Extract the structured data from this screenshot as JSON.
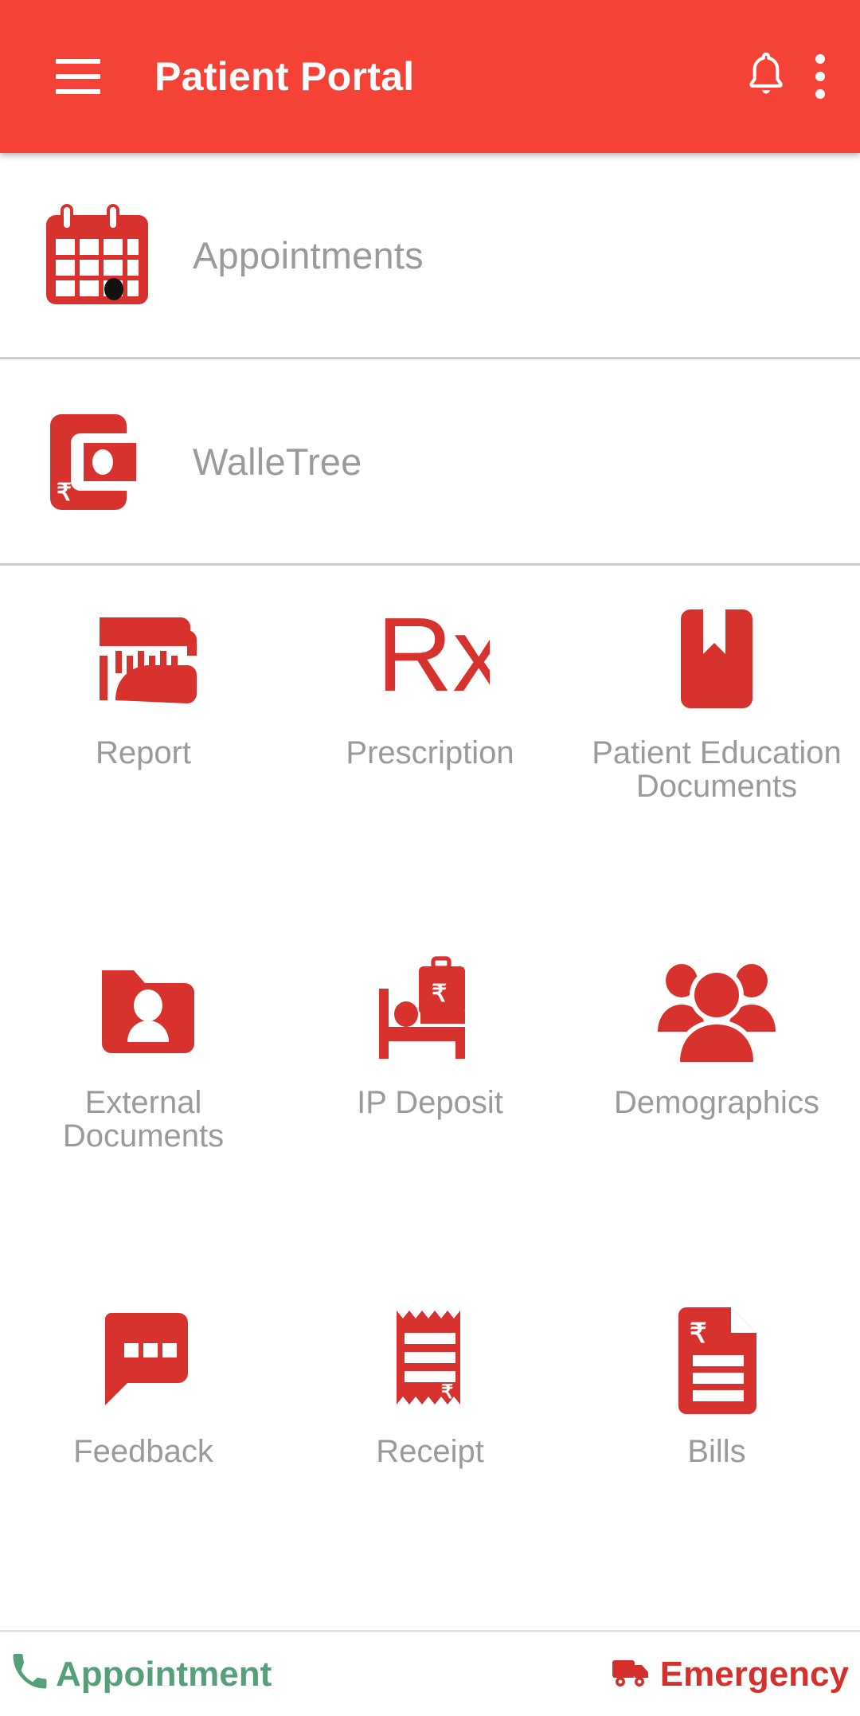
{
  "appbar": {
    "title": "Patient Portal",
    "menu_icon": "hamburger-menu-icon",
    "notification_icon": "bell-icon",
    "overflow_icon": "more-vertical-icon"
  },
  "list_rows": [
    {
      "label": "Appointments",
      "icon": "calendar-icon"
    },
    {
      "label": "WalleTree",
      "icon": "wallet-rupee-icon"
    }
  ],
  "grid": [
    {
      "label": "Report",
      "icon": "folder-chart-icon"
    },
    {
      "label": "Prescription",
      "icon": "rx-icon",
      "glyph": "Rx"
    },
    {
      "label": "Patient Education Documents",
      "icon": "book-bookmark-icon"
    },
    {
      "label": "External Documents",
      "icon": "folder-person-icon"
    },
    {
      "label": "IP Deposit",
      "icon": "bed-money-bag-icon"
    },
    {
      "label": "Demographics",
      "icon": "people-group-icon"
    },
    {
      "label": "Feedback",
      "icon": "chat-bubble-dots-icon"
    },
    {
      "label": "Receipt",
      "icon": "receipt-rupee-icon"
    },
    {
      "label": "Bills",
      "icon": "document-rupee-icon"
    }
  ],
  "bottom_bar": {
    "appointment_label": "Appointment",
    "appointment_icon": "phone-icon",
    "emergency_label": "Emergency",
    "emergency_icon": "ambulance-icon"
  },
  "colors": {
    "appbar_red": "#F44336",
    "icon_red": "#D7322E",
    "label_gray": "#9A9A9A",
    "divider_gray": "#CCCCCC",
    "appointment_green": "#55A07A",
    "emergency_red": "#D6302C"
  }
}
